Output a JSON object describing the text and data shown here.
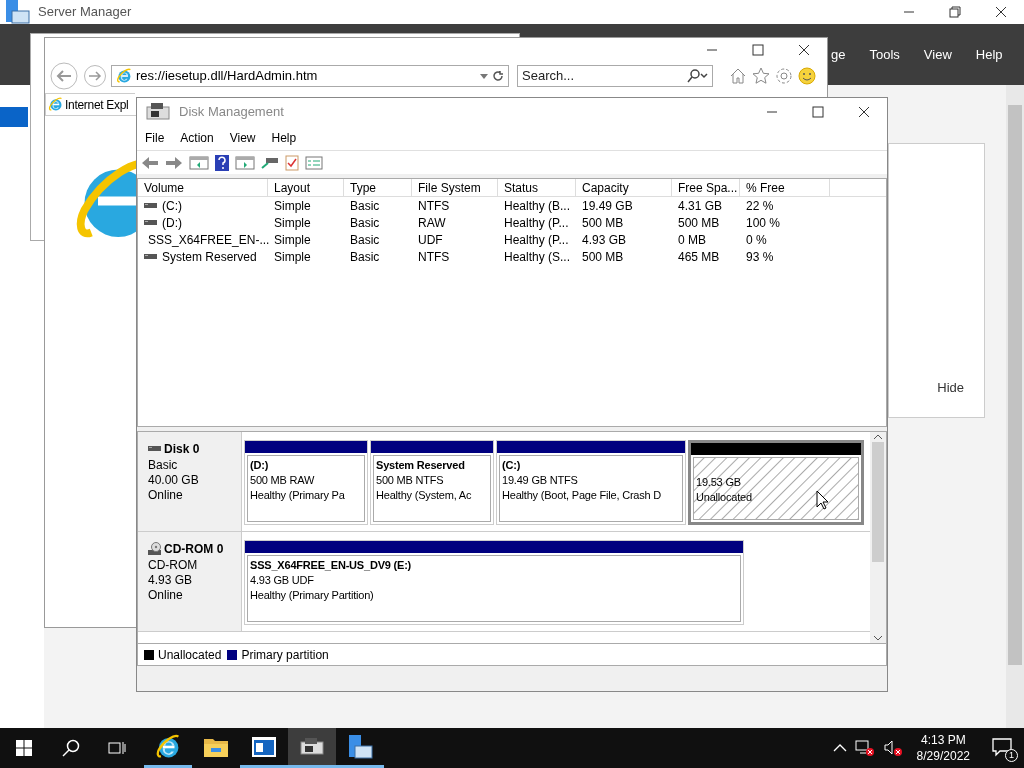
{
  "server_manager": {
    "title": "Server Manager",
    "menu": [
      "ge",
      "Tools",
      "View",
      "Help"
    ],
    "hide_link": "Hide"
  },
  "browser": {
    "address": "res://iesetup.dll/HardAdmin.htm",
    "search_placeholder": "Search...",
    "tab": "Internet Expl"
  },
  "disk_management": {
    "title": "Disk Management",
    "menu": [
      "File",
      "Action",
      "View",
      "Help"
    ],
    "columns": [
      "Volume",
      "Layout",
      "Type",
      "File System",
      "Status",
      "Capacity",
      "Free Spa...",
      "% Free"
    ],
    "rows": [
      {
        "kind": "disk",
        "cells": [
          "(C:)",
          "Simple",
          "Basic",
          "NTFS",
          "Healthy (B...",
          "19.49 GB",
          "4.31 GB",
          "22 %"
        ]
      },
      {
        "kind": "disk",
        "cells": [
          "(D:)",
          "Simple",
          "Basic",
          "RAW",
          "Healthy (P...",
          "500 MB",
          "500 MB",
          "100 %"
        ]
      },
      {
        "kind": "cd",
        "cells": [
          "SSS_X64FREE_EN-...",
          "Simple",
          "Basic",
          "UDF",
          "Healthy (P...",
          "4.93 GB",
          "0 MB",
          "0 %"
        ]
      },
      {
        "kind": "disk",
        "cells": [
          "System Reserved",
          "Simple",
          "Basic",
          "NTFS",
          "Healthy (S...",
          "500 MB",
          "465 MB",
          "93 %"
        ]
      }
    ],
    "disks": [
      {
        "kind": "disk",
        "name": "Disk 0",
        "lines": [
          "Basic",
          "40.00 GB",
          "Online"
        ],
        "partitions": [
          {
            "kind": "primary",
            "selected": false,
            "name": "(D:)",
            "size": "500 MB RAW",
            "status": "Healthy (Primary Pa"
          },
          {
            "kind": "primary",
            "selected": false,
            "name": "System Reserved",
            "size": "500 MB NTFS",
            "status": "Healthy (System, Ac"
          },
          {
            "kind": "primary",
            "selected": false,
            "name": "(C:)",
            "size": "19.49 GB NTFS",
            "status": "Healthy (Boot, Page File, Crash D"
          },
          {
            "kind": "unallocated",
            "selected": true,
            "size": "19.53 GB",
            "status": "Unallocated"
          }
        ]
      },
      {
        "kind": "cd",
        "name": "CD-ROM 0",
        "lines": [
          "CD-ROM",
          "4.93 GB",
          "Online"
        ],
        "partitions": [
          {
            "kind": "primary",
            "selected": false,
            "name": "SSS_X64FREE_EN-US_DV9  (E:)",
            "size": "4.93 GB UDF",
            "status": "Healthy (Primary Partition)"
          }
        ]
      }
    ],
    "legend": [
      {
        "label": "Unallocated",
        "color": "#000000"
      },
      {
        "label": "Primary partition",
        "color": "#000080"
      }
    ]
  },
  "taskbar": {
    "time": "4:13 PM",
    "date": "8/29/2022",
    "notification_count": "1",
    "apps": [
      {
        "kind": "ie",
        "running": true,
        "selected": false
      },
      {
        "kind": "folder",
        "running": false,
        "selected": false
      },
      {
        "kind": "window",
        "running": true,
        "selected": false
      },
      {
        "kind": "disk",
        "running": true,
        "selected": true
      },
      {
        "kind": "server",
        "running": true,
        "selected": false
      }
    ]
  }
}
